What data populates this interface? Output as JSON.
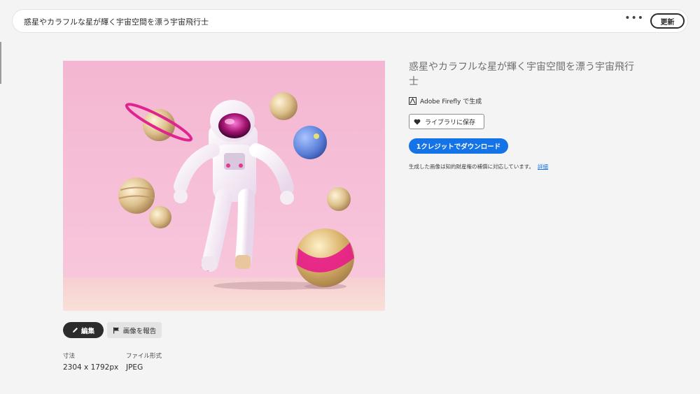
{
  "prompt": "惑星やカラフルな星が輝く宇宙空間を漂う宇宙飛行士",
  "toolbar": {
    "more_label": "•••",
    "refresh_label": "更新"
  },
  "details": {
    "title": "惑星やカラフルな星が輝く宇宙空間を漂う宇宙飛行士",
    "generated_with": "Adobe Firefly で生成",
    "save_label": "ライブラリに保存",
    "download_label": "1クレジットでダウンロード",
    "notice": "生成した画像は知的財産権の補償に対応しています。",
    "notice_link": "詳細"
  },
  "actions": {
    "edit_label": "編集",
    "report_label": "画像を報告"
  },
  "meta": {
    "size_label": "寸法",
    "size_value": "2304 x 1792px",
    "format_label": "ファイル形式",
    "format_value": "JPEG"
  },
  "colors": {
    "accent": "#1473e6",
    "image_bg": "#f5bdd6",
    "floor": "#f7d6d2"
  },
  "icons": [
    "more-icon",
    "firefly-icon",
    "heart-icon",
    "pencil-icon",
    "flag-icon"
  ]
}
